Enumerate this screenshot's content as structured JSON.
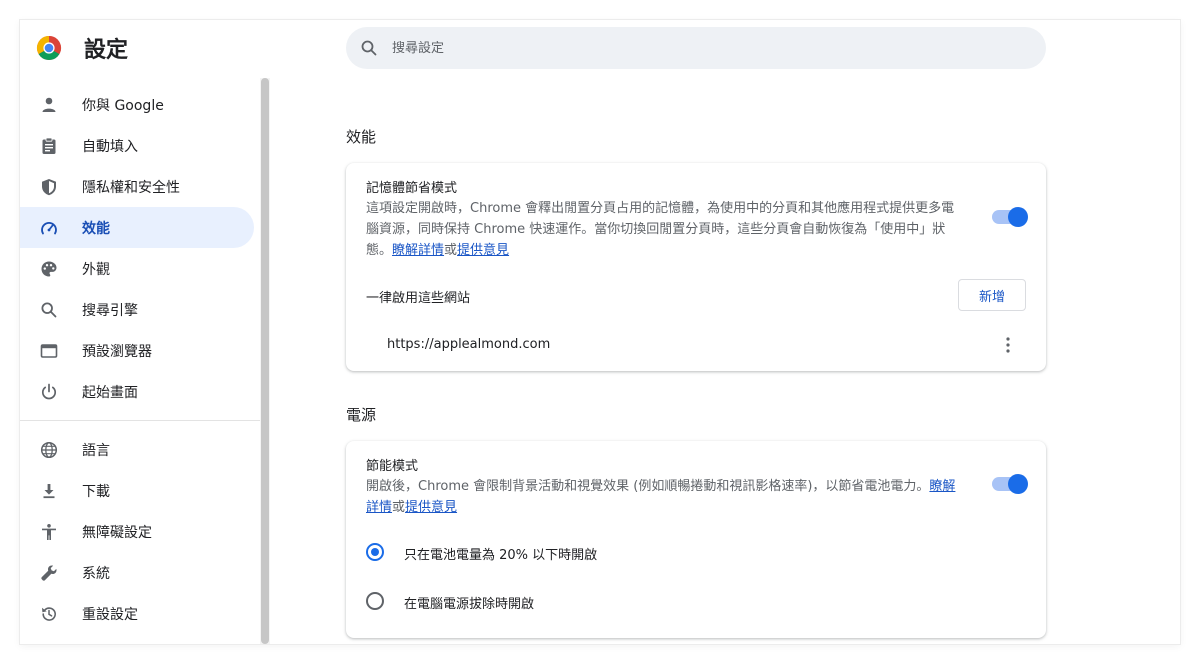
{
  "app": {
    "title": "設定",
    "search_placeholder": "搜尋設定"
  },
  "sidebar": {
    "active_index": 3,
    "items": [
      {
        "label": "你與 Google",
        "icon": "person-icon"
      },
      {
        "label": "自動填入",
        "icon": "clipboard-icon"
      },
      {
        "label": "隱私權和安全性",
        "icon": "shield-icon"
      },
      {
        "label": "效能",
        "icon": "speedometer-icon"
      },
      {
        "label": "外觀",
        "icon": "palette-icon"
      },
      {
        "label": "搜尋引擎",
        "icon": "search-icon"
      },
      {
        "label": "預設瀏覽器",
        "icon": "browser-window-icon"
      },
      {
        "label": "起始畫面",
        "icon": "power-icon"
      },
      {
        "label": "語言",
        "icon": "globe-icon"
      },
      {
        "label": "下載",
        "icon": "download-icon"
      },
      {
        "label": "無障礙設定",
        "icon": "accessibility-icon"
      },
      {
        "label": "系統",
        "icon": "wrench-icon"
      },
      {
        "label": "重設設定",
        "icon": "reset-history-icon"
      }
    ]
  },
  "performance": {
    "section_title": "效能",
    "memory_saver": {
      "title": "記憶體節省模式",
      "description": "這項設定開啟時，Chrome 會釋出閒置分頁占用的記憶體，為使用中的分頁和其他應用程式提供更多電腦資源，同時保持 Chrome 快速運作。當你切換回閒置分頁時，這些分頁會自動恢復為「使用中」狀態。",
      "learn_more": "瞭解詳情",
      "or": "或",
      "feedback": "提供意見",
      "enabled": true
    },
    "always_active": {
      "label": "一律啟用這些網站",
      "add_button": "新增",
      "sites": [
        "https://applealmond.com"
      ]
    }
  },
  "power": {
    "section_title": "電源",
    "energy_saver": {
      "title": "節能模式",
      "description": "開啟後，Chrome 會限制背景活動和視覺效果 (例如順暢捲動和視訊影格速率)，以節省電池電力。",
      "learn_more": "瞭解詳情",
      "or": "或",
      "feedback": "提供意見",
      "enabled": true
    },
    "options": [
      {
        "label": "只在電池電量為 20% 以下時開啟",
        "checked": true
      },
      {
        "label": "在電腦電源拔除時開啟",
        "checked": false
      }
    ]
  },
  "colors": {
    "accent": "#1a6ce8",
    "active_nav_bg": "#e8f0fe",
    "link": "#1a56c6"
  }
}
